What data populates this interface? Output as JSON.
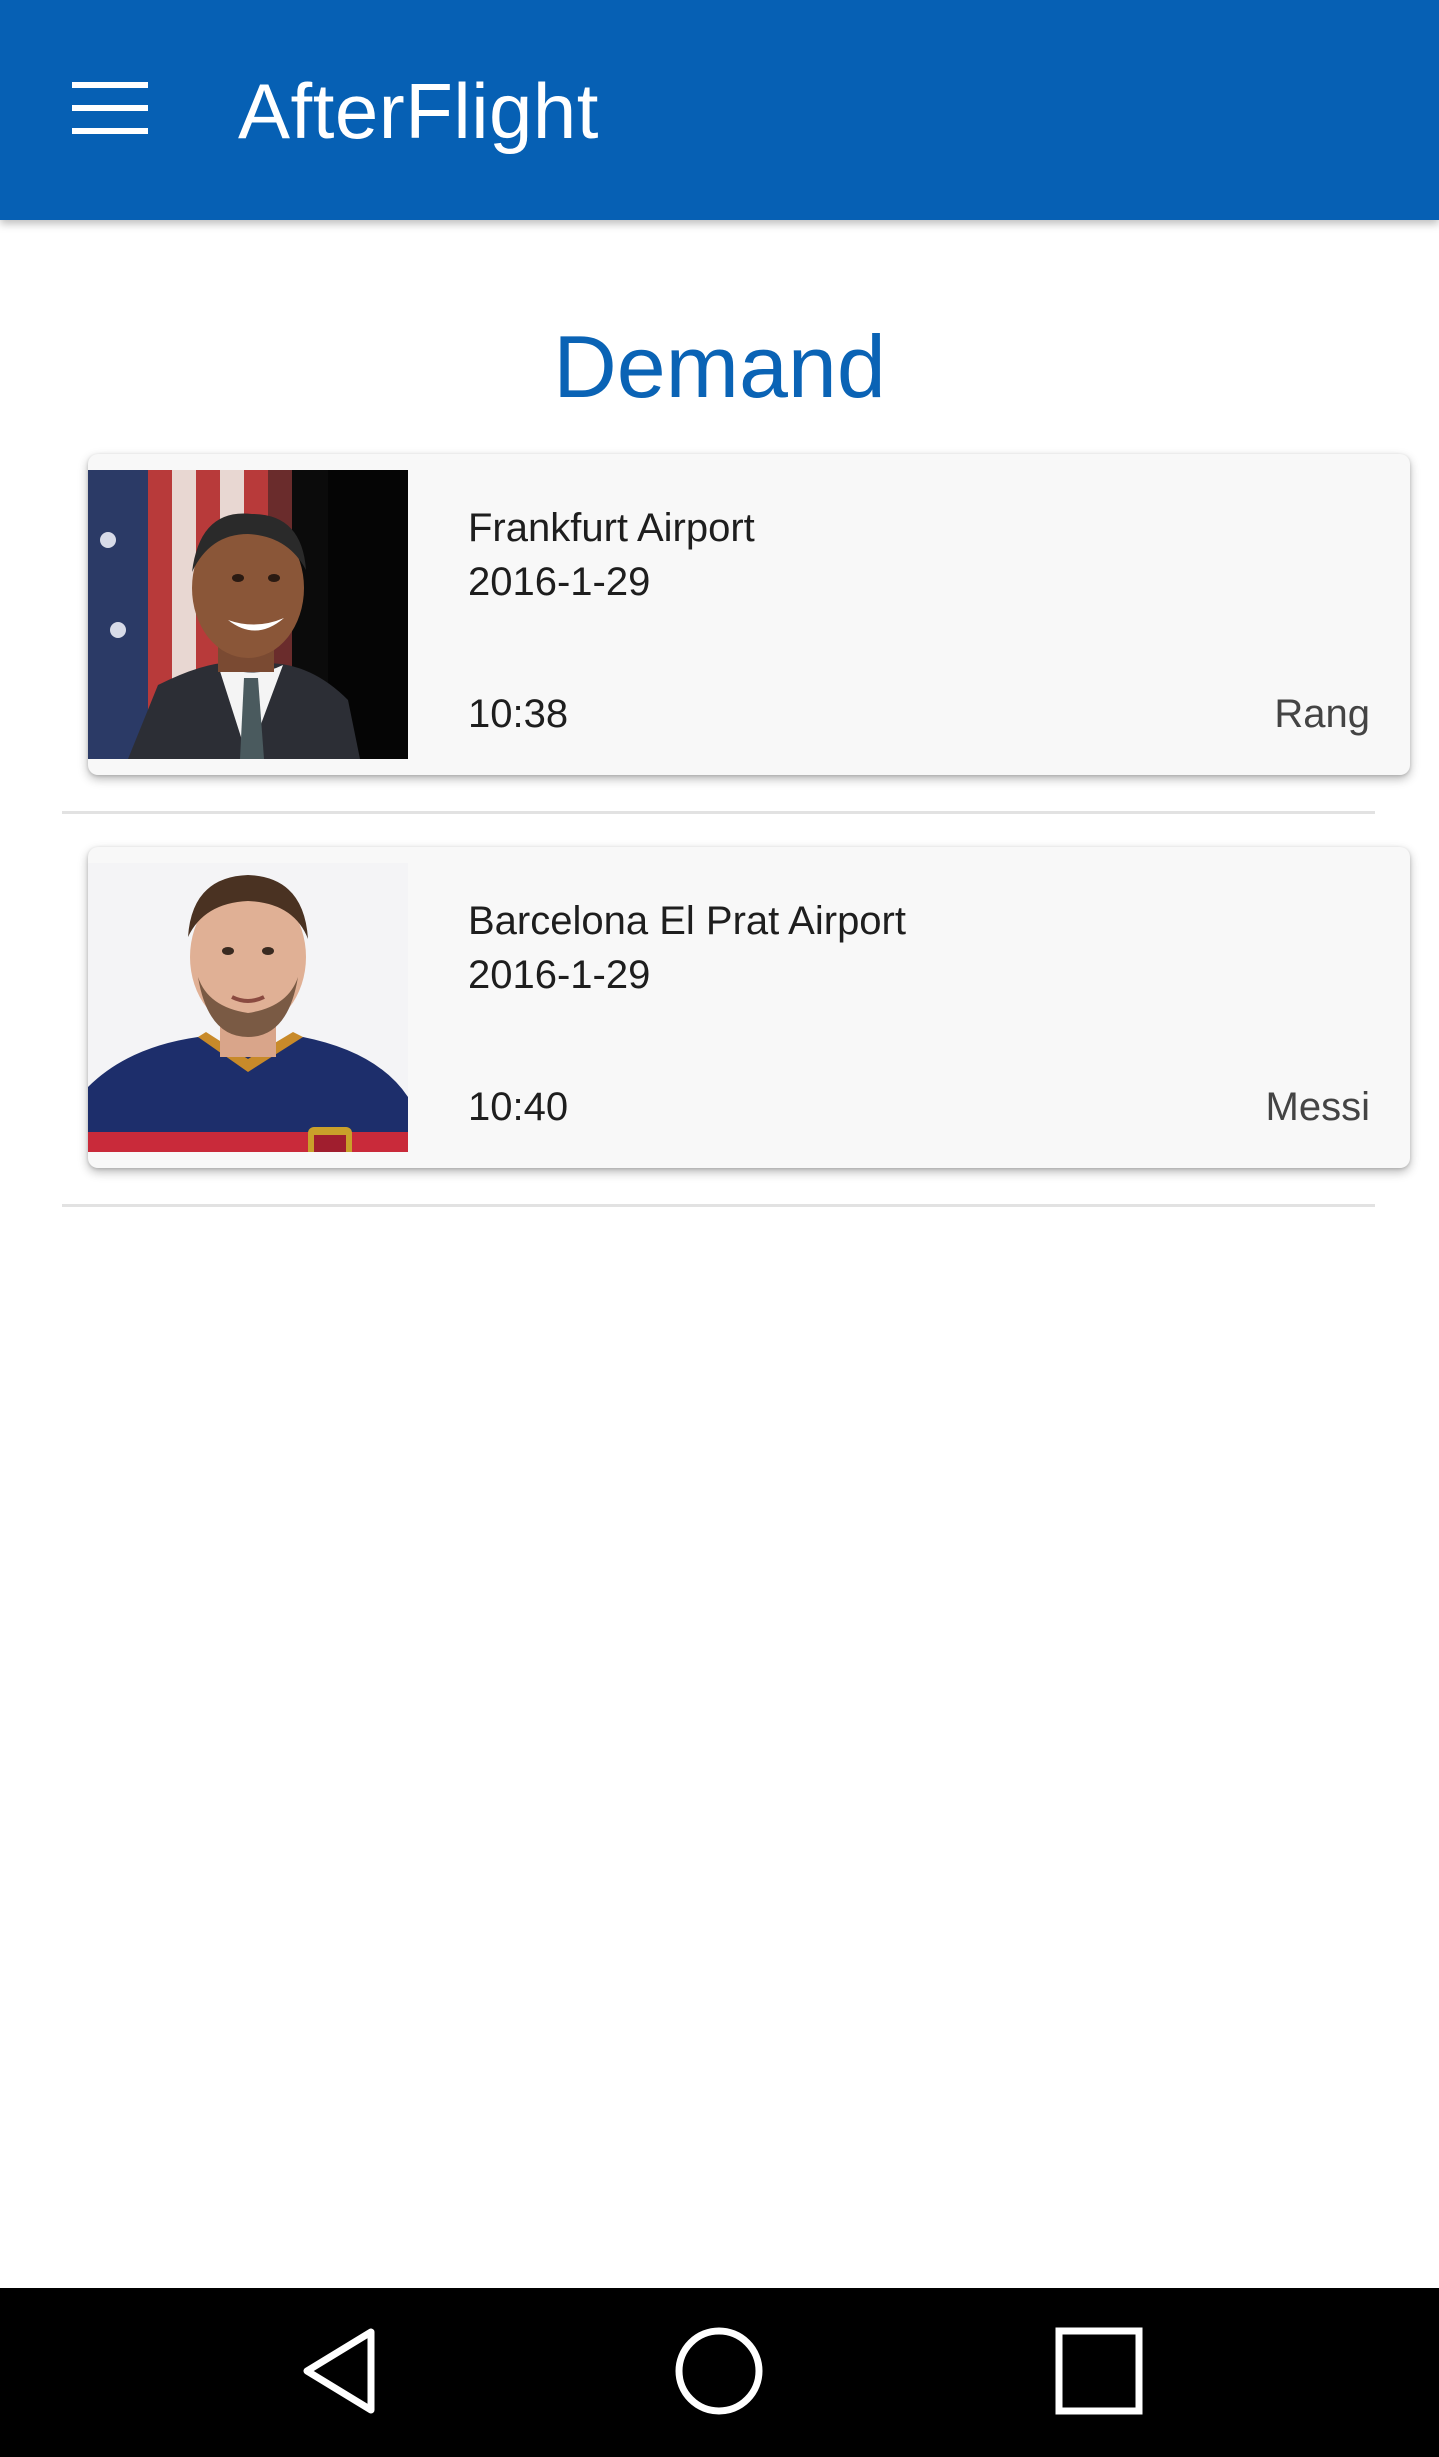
{
  "appbar": {
    "title": "AfterFlight",
    "background": "#0660b4",
    "menu_icon": "hamburger-menu-icon"
  },
  "page": {
    "heading": "Demand",
    "heading_color": "#0a63b5"
  },
  "items": [
    {
      "airport": "Frankfurt Airport",
      "date": "2016-1-29",
      "time": "10:38",
      "person": "Rang",
      "photo": "portrait-photo-man-in-suit"
    },
    {
      "airport": "Barcelona El Prat Airport",
      "date": "2016-1-29",
      "time": "10:40",
      "person": "Messi",
      "photo": "portrait-photo-man-in-jersey"
    }
  ],
  "navbar": {
    "back_icon": "back-triangle-icon",
    "home_icon": "home-circle-icon",
    "recents_icon": "recents-square-icon"
  }
}
